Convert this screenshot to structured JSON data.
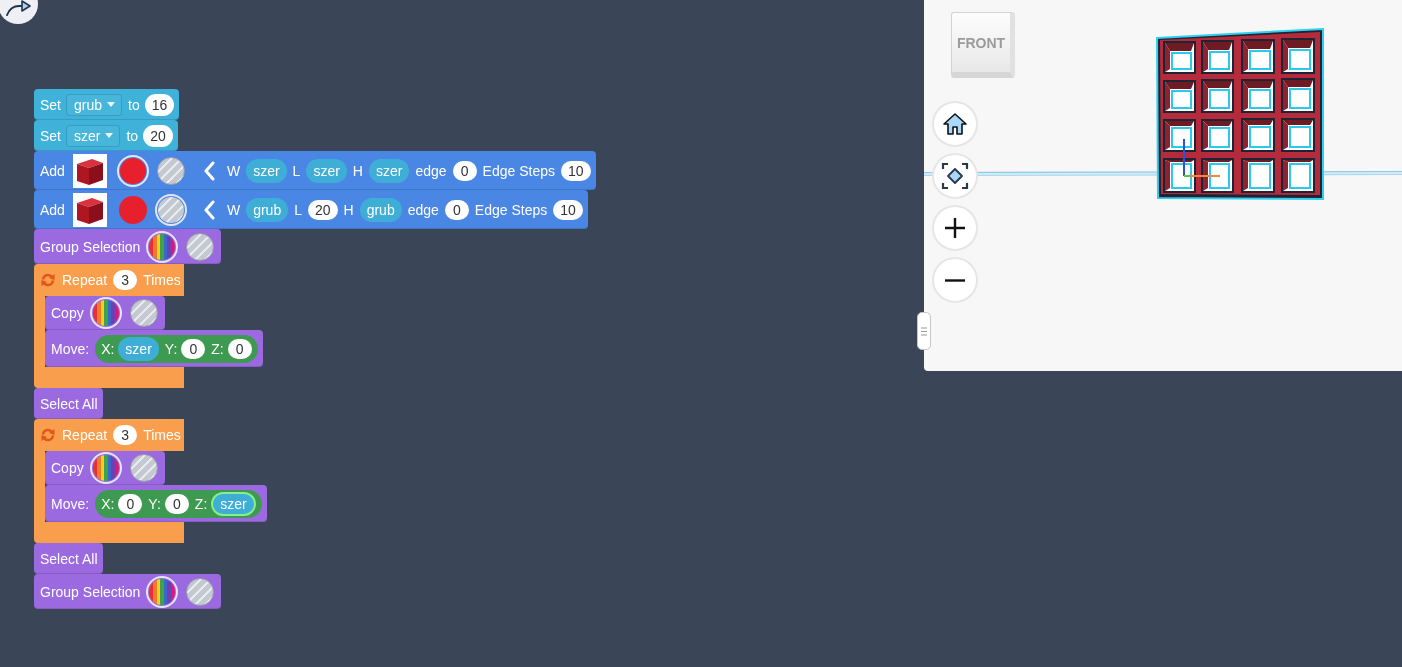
{
  "workspace": {
    "blocks": [
      {
        "kind": "set",
        "label": "Set",
        "variable": "grub",
        "connector": "to",
        "value": "16"
      },
      {
        "kind": "set",
        "label": "Set",
        "variable": "szer",
        "connector": "to",
        "value": "20"
      },
      {
        "kind": "add",
        "label": "Add",
        "swatches": [
          {
            "kind": "color",
            "color": "#e8202e",
            "selected": true
          },
          {
            "kind": "hole",
            "selected": false
          }
        ],
        "params": [
          {
            "label": "W",
            "kind": "variable",
            "value": "szer"
          },
          {
            "label": "L",
            "kind": "variable",
            "value": "szer"
          },
          {
            "label": "H",
            "kind": "variable",
            "value": "szer"
          },
          {
            "label": "edge",
            "kind": "number",
            "value": "0"
          },
          {
            "label": "Edge Steps",
            "kind": "number",
            "value": "10"
          }
        ]
      },
      {
        "kind": "add",
        "label": "Add",
        "swatches": [
          {
            "kind": "color",
            "color": "#e8202e",
            "selected": false
          },
          {
            "kind": "hole",
            "selected": true
          }
        ],
        "params": [
          {
            "label": "W",
            "kind": "variable",
            "value": "grub"
          },
          {
            "label": "L",
            "kind": "number",
            "value": "20"
          },
          {
            "label": "H",
            "kind": "variable",
            "value": "grub"
          },
          {
            "label": "edge",
            "kind": "number",
            "value": "0"
          },
          {
            "label": "Edge Steps",
            "kind": "number",
            "value": "10"
          }
        ]
      },
      {
        "kind": "group",
        "label": "Group Selection",
        "swatches": [
          {
            "kind": "rainbow",
            "selected": true
          },
          {
            "kind": "hole",
            "selected": false
          }
        ]
      },
      {
        "kind": "repeat",
        "label": "Repeat",
        "count": "3",
        "suffix": "Times",
        "children": [
          {
            "kind": "copy",
            "label": "Copy",
            "swatches": [
              {
                "kind": "rainbow",
                "selected": true
              },
              {
                "kind": "hole",
                "selected": false
              }
            ]
          },
          {
            "kind": "move",
            "label": "Move:",
            "params": [
              {
                "label": "X:",
                "kind": "variable",
                "value": "szer",
                "highlighted": false
              },
              {
                "label": "Y:",
                "kind": "number",
                "value": "0",
                "highlighted": false
              },
              {
                "label": "Z:",
                "kind": "number",
                "value": "0",
                "highlighted": false
              }
            ]
          }
        ]
      },
      {
        "kind": "select_all",
        "label": "Select All"
      },
      {
        "kind": "repeat",
        "label": "Repeat",
        "count": "3",
        "suffix": "Times",
        "children": [
          {
            "kind": "copy",
            "label": "Copy",
            "swatches": [
              {
                "kind": "rainbow",
                "selected": true
              },
              {
                "kind": "hole",
                "selected": false
              }
            ]
          },
          {
            "kind": "move",
            "label": "Move:",
            "params": [
              {
                "label": "X:",
                "kind": "number",
                "value": "0",
                "highlighted": false
              },
              {
                "label": "Y:",
                "kind": "number",
                "value": "0",
                "highlighted": false
              },
              {
                "label": "Z:",
                "kind": "variable",
                "value": "szer",
                "highlighted": true
              }
            ]
          }
        ]
      },
      {
        "kind": "select_all",
        "label": "Select All"
      },
      {
        "kind": "group",
        "label": "Group Selection",
        "swatches": [
          {
            "kind": "rainbow",
            "selected": true
          },
          {
            "kind": "hole",
            "selected": false
          }
        ]
      }
    ]
  },
  "viewer": {
    "view_cube": {
      "label": "FRONT"
    }
  }
}
